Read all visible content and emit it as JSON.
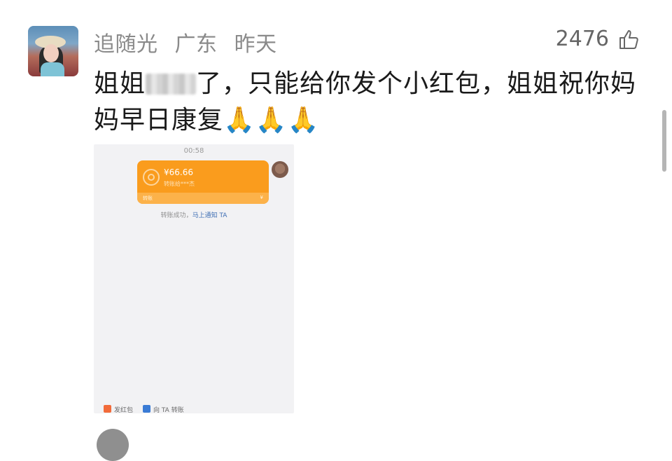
{
  "comment": {
    "username": "追随光",
    "location": "广东",
    "time": "昨天",
    "likes": "2476",
    "text_before_blur": "姐姐",
    "text_after_blur": "了，只能给你发个小红包，姐姐祝你妈妈早日康复",
    "emoji": "🙏🙏🙏"
  },
  "screenshot": {
    "time": "00:58",
    "amount": "¥66.66",
    "sub_text": "转账给***杰",
    "footer_left": "转账",
    "footer_right": "¥",
    "notice_text": "转账成功，",
    "notice_link": "马上通知 TA",
    "bottom_left": "发红包",
    "bottom_right": "向 TA 转账"
  },
  "colors": {
    "accent": "#fa9c1d",
    "link": "#3f6fb4",
    "meta": "#8a8a8a"
  },
  "icons": [
    "thumbs-up-icon",
    "coin-icon",
    "red-packet-icon",
    "transfer-icon"
  ]
}
